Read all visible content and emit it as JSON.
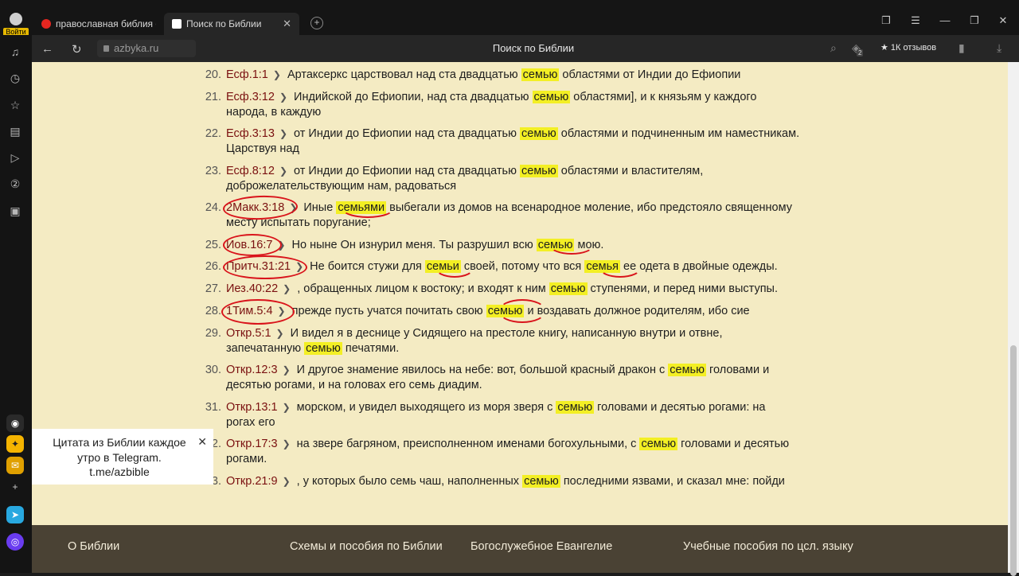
{
  "browser": {
    "account_label": "Войти",
    "tabs": [
      {
        "title": "православная библия он",
        "active": false
      },
      {
        "title": "Поиск по Библии",
        "active": true
      }
    ],
    "new_tab_symbol": "+",
    "url": "azbyka.ru",
    "page_title": "Поиск по Библии",
    "reviews_label": "★ 1К отзывов",
    "notification_count": "2"
  },
  "results": [
    {
      "num": "20.",
      "ref": "Есф.1:1",
      "lines": [
        [
          "Артаксеркс царствовал над ста двадцатью ",
          "семью",
          " областями от Индии до Ефиопии"
        ]
      ]
    },
    {
      "num": "21.",
      "ref": "Есф.3:12",
      "lines": [
        [
          "Индийской до Ефиопии, над ста двадцатью ",
          "семью",
          " областями], и к князьям у каждого"
        ],
        [
          "народа, в каждую",
          "",
          ""
        ]
      ]
    },
    {
      "num": "22.",
      "ref": "Есф.3:13",
      "lines": [
        [
          "от Индии до Ефиопии над ста двадцатью ",
          "семью",
          " областями и подчиненным им наместникам."
        ],
        [
          "Царствуя над",
          "",
          ""
        ]
      ]
    },
    {
      "num": "23.",
      "ref": "Есф.8:12",
      "lines": [
        [
          "от Индии до Ефиопии над ста двадцатью ",
          "семью",
          " областями и властителям,"
        ],
        [
          "доброжелательствующим нам, радоваться",
          "",
          ""
        ]
      ]
    },
    {
      "num": "24.",
      "ref": "2Макк.3:18",
      "lines": [
        [
          "Иные ",
          "семьями",
          " выбегали из домов на всенародное моление, ибо предстояло священному"
        ],
        [
          "месту испытать поругание;",
          "",
          ""
        ]
      ]
    },
    {
      "num": "25.",
      "ref": "Иов.16:7",
      "lines": [
        [
          "Но ныне Он изнурил меня. Ты разрушил всю ",
          "семью",
          " мою."
        ]
      ]
    },
    {
      "num": "26.",
      "ref": "Притч.31:21",
      "lines": [
        [
          "Не боится стужи для ",
          "семьи",
          " своей, потому что вся ",
          "семья",
          " ее одета в двойные одежды."
        ]
      ]
    },
    {
      "num": "27.",
      "ref": "Иез.40:22",
      "lines": [
        [
          ", обращенных лицом к востоку; и входят к ним ",
          "семью",
          " ступенями, и перед ними выступы."
        ]
      ]
    },
    {
      "num": "28.",
      "ref": "1Тим.5:4",
      "lines": [
        [
          "прежде пусть учатся почитать свою ",
          "семью",
          " и воздавать должное родителям, ибо сие"
        ]
      ]
    },
    {
      "num": "29.",
      "ref": "Откр.5:1",
      "lines": [
        [
          "И видел я в деснице у Сидящего на престоле книгу, написанную внутри и отвне,",
          "",
          ""
        ],
        [
          "запечатанную ",
          "семью",
          " печатями."
        ]
      ]
    },
    {
      "num": "30.",
      "ref": "Откр.12:3",
      "lines": [
        [
          "И другое знамение явилось на небе: вот, большой красный дракон с ",
          "семью",
          " головами и"
        ],
        [
          "десятью рогами, и на головах его семь диадим.",
          "",
          ""
        ]
      ]
    },
    {
      "num": "31.",
      "ref": "Откр.13:1",
      "lines": [
        [
          "морском, и увидел выходящего из моря зверя с ",
          "семью",
          " головами и десятью рогами: на"
        ],
        [
          "рогах его",
          "",
          ""
        ]
      ]
    },
    {
      "num": "32.",
      "ref": "Откр.17:3",
      "lines": [
        [
          "на звере багряном, преисполненном именами богохульными, с ",
          "семью",
          " головами и десятью"
        ],
        [
          "рогами.",
          "",
          ""
        ]
      ]
    },
    {
      "num": "33.",
      "ref": "Откр.21:9",
      "lines": [
        [
          ", у которых было семь чаш, наполненных ",
          "семью",
          " последними язвами, и сказал мне: пойди"
        ]
      ]
    }
  ],
  "popup": {
    "line1": "Цитата из Библии каждое",
    "line2": "утро в Telegram.",
    "link": "t.me/azbible",
    "close": "✕"
  },
  "footer": {
    "links": [
      "О Библии",
      "Схемы и пособия по Библии",
      "Богослужебное Евангелие",
      "Учебные пособия по цсл. языку"
    ]
  },
  "colors": {
    "page_bg": "#f4ebc3",
    "highlight": "#f3ef24",
    "ref": "#7a1010",
    "annotation": "#d9141b",
    "footer_bg": "#4a4234"
  }
}
